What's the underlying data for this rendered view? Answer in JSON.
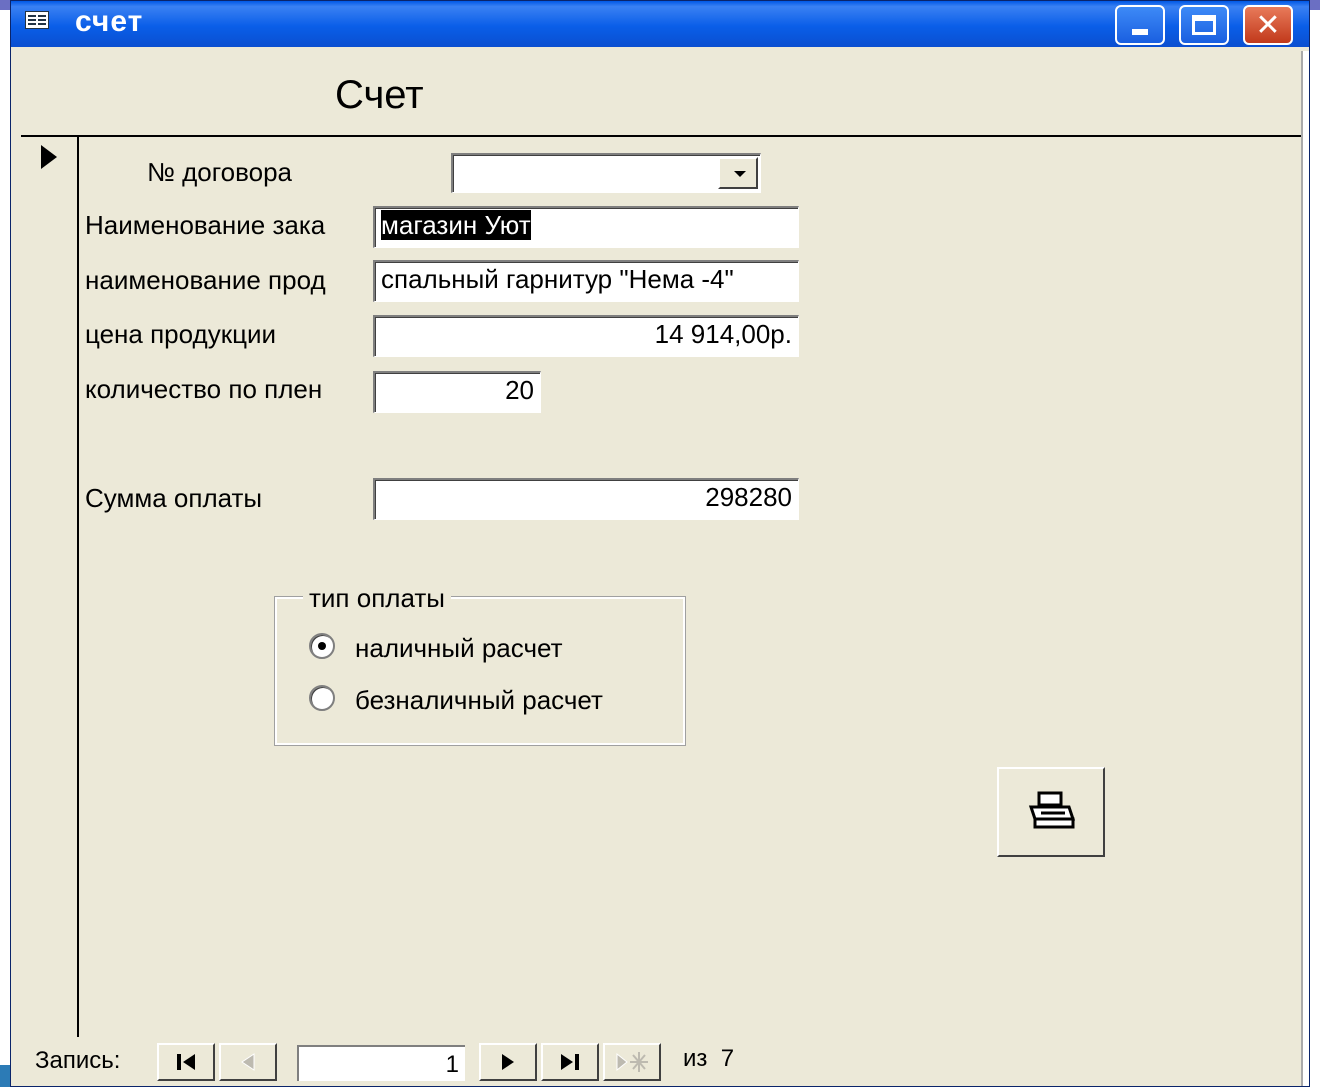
{
  "window": {
    "title": "счет",
    "icon": "form-icon",
    "controls": [
      "minimize-icon",
      "maximize-icon",
      "close-icon"
    ],
    "close_glyph": "✕"
  },
  "form": {
    "title": "Счет",
    "fields": {
      "contract_label": "№ договора",
      "contract_value": "",
      "customer_label": "Наименование зака",
      "customer_value": "магазин Уют",
      "product_label": "наименование прод",
      "product_value": "спальный гарнитур \"Нема -4\"",
      "price_label": "цена продукции",
      "price_value": "14 914,00р.",
      "quantity_label": "количество по плен",
      "quantity_value": "20",
      "total_label": "Сумма оплаты",
      "total_value": "298280"
    },
    "payment_group": {
      "legend": "тип оплаты",
      "options": [
        {
          "label": "наличный расчет",
          "checked": true
        },
        {
          "label": "безналичный расчет",
          "checked": false
        }
      ]
    },
    "print_button_icon": "printer-icon"
  },
  "navigation": {
    "label": "Запись:",
    "current": "1",
    "of_label": "из",
    "total": "7",
    "buttons": [
      "first-record-icon",
      "prev-record-icon",
      "next-record-icon",
      "last-record-icon",
      "new-record-icon"
    ]
  },
  "colors": {
    "titlebar": "#0a5ee8",
    "window_bg": "#ece9d8",
    "selection": "#000000"
  }
}
